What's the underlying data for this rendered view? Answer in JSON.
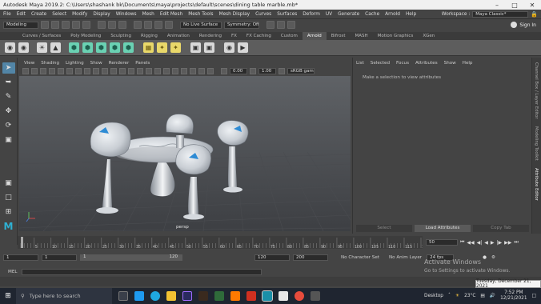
{
  "window": {
    "title": "Autodesk Maya 2019.2: C:\\Users\\shashank bk\\Documents\\maya\\projects\\default\\scenes\\dining table marble.mb*"
  },
  "menubar": {
    "items": [
      "File",
      "Edit",
      "Create",
      "Select",
      "Modify",
      "Display",
      "Windows",
      "Mesh",
      "Edit Mesh",
      "Mesh Tools",
      "Mesh Display",
      "Curves",
      "Surfaces",
      "Deform",
      "UV",
      "Generate",
      "Cache",
      "Arnold",
      "Help"
    ],
    "workspace_label": "Workspace :",
    "workspace_value": "Maya Classic*"
  },
  "statusline": {
    "mode": "Modeling",
    "live_surface": "No Live Surface",
    "symmetry": "Symmetry: Off",
    "sign_in": "Sign In"
  },
  "shelf_tabs": [
    "Curves / Surfaces",
    "Poly Modeling",
    "Sculpting",
    "Rigging",
    "Animation",
    "Rendering",
    "FX",
    "FX Caching",
    "Custom",
    "Arnold",
    "Bifrost",
    "MASH",
    "Motion Graphics",
    "XGen"
  ],
  "shelf_active": "Arnold",
  "viewport_menu": [
    "View",
    "Shading",
    "Lighting",
    "Show",
    "Renderer",
    "Panels"
  ],
  "viewport_fields": {
    "exposure": "0.00",
    "gamma": "1.00",
    "colorspace": "sRGB gamma"
  },
  "viewport_camera": "persp",
  "attr_menu": [
    "List",
    "Selected",
    "Focus",
    "Attributes",
    "Show",
    "Help"
  ],
  "attr_message": "Make a selection to view attributes",
  "attr_buttons": [
    "Select",
    "Load Attributes",
    "Copy Tab"
  ],
  "side_tabs": [
    "Channel Box / Layer Editor",
    "Modeling Toolkit",
    "Attribute Editor"
  ],
  "timeline": {
    "ticks": [
      "5",
      "10",
      "15",
      "20",
      "25",
      "30",
      "35",
      "40",
      "45",
      "50",
      "55",
      "60",
      "65",
      "70",
      "75",
      "80",
      "85",
      "90",
      "95",
      "100",
      "105",
      "110",
      "115",
      "120"
    ],
    "current_frame": "1",
    "frame_field": "50"
  },
  "range": {
    "start": "1",
    "start_inner": "1",
    "slider_start": "1",
    "slider_end": "120",
    "end_inner": "120",
    "end": "200",
    "character_set": "No Character Set",
    "anim_layer": "No Anim Layer",
    "fps": "24 fps"
  },
  "mel": {
    "label": "MEL"
  },
  "watermark": {
    "title": "Activate Windows",
    "subtitle": "Go to Settings to activate Windows."
  },
  "taskbar": {
    "search_placeholder": "Type here to search",
    "desktop_label": "Desktop",
    "temperature": "23°C",
    "time": "7:52 PM",
    "date": "12/21/2021",
    "date_tooltip": "Tuesday, December 21, 2021"
  }
}
